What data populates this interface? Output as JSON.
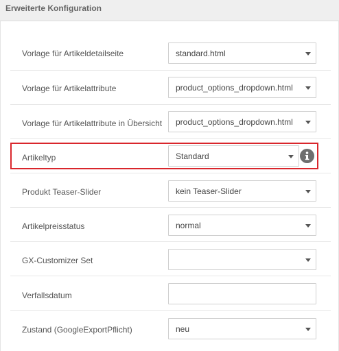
{
  "panel": {
    "title": "Erweiterte Konfiguration"
  },
  "fields": [
    {
      "label": "Vorlage für Artikeldetailseite",
      "value": "standard.html",
      "type": "select"
    },
    {
      "label": "Vorlage für Artikelattribute",
      "value": "product_options_dropdown.html",
      "type": "select"
    },
    {
      "label": "Vorlage für Artikelattribute in Übersicht",
      "value": "product_options_dropdown.html",
      "type": "select"
    },
    {
      "label": "Artikeltyp",
      "value": "Standard",
      "type": "select",
      "highlighted": true,
      "help_icon": "info-icon"
    },
    {
      "label": "Produkt Teaser-Slider",
      "value": "kein Teaser-Slider",
      "type": "select"
    },
    {
      "label": "Artikelpreisstatus",
      "value": "normal",
      "type": "select"
    },
    {
      "label": "GX-Customizer Set",
      "value": "",
      "type": "select"
    },
    {
      "label": "Verfallsdatum",
      "value": "",
      "type": "text"
    },
    {
      "label": "Zustand (GoogleExportPflicht)",
      "value": "neu",
      "type": "select"
    }
  ],
  "colors": {
    "highlight_border": "#d9262c",
    "header_bg": "#efefef",
    "info_icon": "#6e6e6e"
  }
}
